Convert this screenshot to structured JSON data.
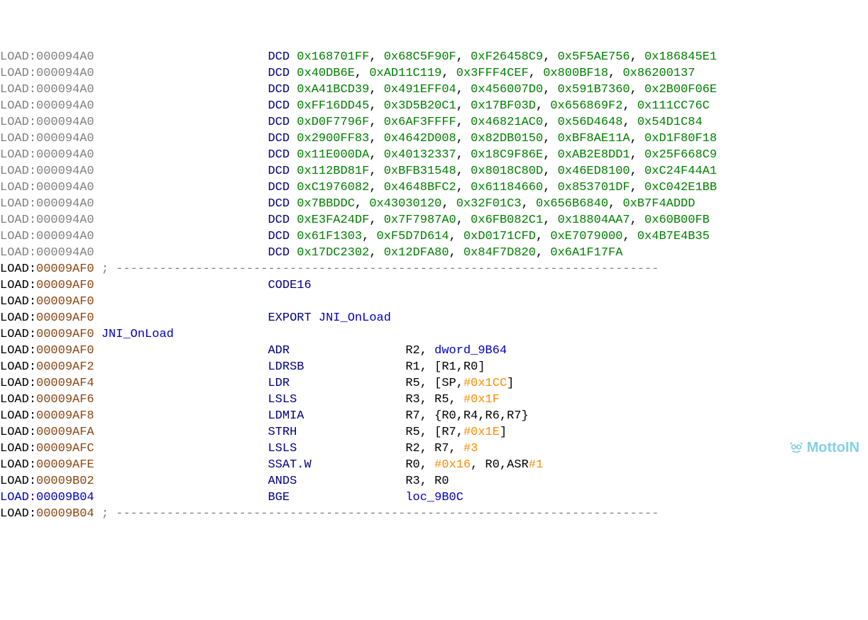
{
  "rows": [
    {
      "addrColor": "gray",
      "addr": "000094A0",
      "type": "dcd",
      "vals": [
        "0x168701FF",
        "0x68C5F90F",
        "0xF26458C9",
        "0x5F5AE756",
        "0x186845E1"
      ]
    },
    {
      "addrColor": "gray",
      "addr": "000094A0",
      "type": "dcd",
      "vals": [
        "0x40DB6E",
        "0xAD11C119",
        "0x3FFF4CEF",
        "0x800BF18",
        "0x86200137"
      ]
    },
    {
      "addrColor": "gray",
      "addr": "000094A0",
      "type": "dcd",
      "vals": [
        "0xA41BCD39",
        "0x491EFF04",
        "0x456007D0",
        "0x591B7360",
        "0x2B00F06E"
      ]
    },
    {
      "addrColor": "gray",
      "addr": "000094A0",
      "type": "dcd",
      "vals": [
        "0xFF16DD45",
        "0x3D5B20C1",
        "0x17BF03D",
        "0x656869F2",
        "0x111CC76C"
      ]
    },
    {
      "addrColor": "gray",
      "addr": "000094A0",
      "type": "dcd",
      "vals": [
        "0xD0F7796F",
        "0x6AF3FFFF",
        "0x46821AC0",
        "0x56D4648",
        "0x54D1C84"
      ]
    },
    {
      "addrColor": "gray",
      "addr": "000094A0",
      "type": "dcd",
      "vals": [
        "0x2900FF83",
        "0x4642D008",
        "0x82DB0150",
        "0xBF8AE11A",
        "0xD1F80F18"
      ]
    },
    {
      "addrColor": "gray",
      "addr": "000094A0",
      "type": "dcd",
      "vals": [
        "0x11E000DA",
        "0x40132337",
        "0x18C9F86E",
        "0xAB2E8DD1",
        "0x25F668C9"
      ]
    },
    {
      "addrColor": "gray",
      "addr": "000094A0",
      "type": "dcd",
      "vals": [
        "0x112BD81F",
        "0xBFB31548",
        "0x8018C80D",
        "0x46ED8100",
        "0xC24F44A1"
      ]
    },
    {
      "addrColor": "gray",
      "addr": "000094A0",
      "type": "dcd",
      "vals": [
        "0xC1976082",
        "0x4648BFC2",
        "0x61184660",
        "0x853701DF",
        "0xC042E1BB"
      ]
    },
    {
      "addrColor": "gray",
      "addr": "000094A0",
      "type": "dcd",
      "vals": [
        "0x7BBDDC",
        "0x43030120",
        "0x32F01C3",
        "0x656B6840",
        "0xB7F4ADDD"
      ]
    },
    {
      "addrColor": "gray",
      "addr": "000094A0",
      "type": "dcd",
      "vals": [
        "0xE3FA24DF",
        "0x7F7987A0",
        "0x6FB082C1",
        "0x18804AA7",
        "0x60B00FB"
      ]
    },
    {
      "addrColor": "gray",
      "addr": "000094A0",
      "type": "dcd",
      "vals": [
        "0x61F1303",
        "0xF5D7D614",
        "0xD0171CFD",
        "0xE7079000",
        "0x4B7E4B35"
      ]
    },
    {
      "addrColor": "gray",
      "addr": "000094A0",
      "type": "dcd",
      "vals": [
        "0x17DC2302",
        "0x12DFA80",
        "0x84F7D820",
        "0x6A1F17FA"
      ]
    },
    {
      "addrColor": "brown",
      "addr": "00009AF0",
      "type": "sep"
    },
    {
      "addrColor": "brown",
      "addr": "00009AF0",
      "type": "plain",
      "mnemonic": "CODE16"
    },
    {
      "addrColor": "brown",
      "addr": "00009AF0",
      "type": "blank"
    },
    {
      "addrColor": "brown",
      "addr": "00009AF0",
      "type": "export",
      "mnemonic": "EXPORT",
      "target": "JNI_OnLoad"
    },
    {
      "addrColor": "brown",
      "addr": "00009AF0",
      "type": "label",
      "label": "JNI_OnLoad"
    },
    {
      "addrColor": "brown",
      "addr": "00009AF0",
      "type": "instr",
      "mnemonic": "ADR",
      "ops": [
        {
          "t": "plain",
          "v": "R2, "
        },
        {
          "t": "label",
          "v": "dword_9B64"
        }
      ]
    },
    {
      "addrColor": "brown",
      "addr": "00009AF2",
      "type": "instr",
      "mnemonic": "LDRSB",
      "ops": [
        {
          "t": "plain",
          "v": "R1, [R1,R0]"
        }
      ]
    },
    {
      "addrColor": "brown",
      "addr": "00009AF4",
      "type": "instr",
      "mnemonic": "LDR",
      "ops": [
        {
          "t": "plain",
          "v": "R5, [SP,"
        },
        {
          "t": "imm",
          "v": "#0x1CC"
        },
        {
          "t": "plain",
          "v": "]"
        }
      ]
    },
    {
      "addrColor": "brown",
      "addr": "00009AF6",
      "type": "instr",
      "mnemonic": "LSLS",
      "ops": [
        {
          "t": "plain",
          "v": "R3, R5, "
        },
        {
          "t": "imm",
          "v": "#0x1F"
        }
      ]
    },
    {
      "addrColor": "brown",
      "addr": "00009AF8",
      "type": "instr",
      "mnemonic": "LDMIA",
      "ops": [
        {
          "t": "plain",
          "v": "R7, {R0,R4,R6,R7}"
        }
      ]
    },
    {
      "addrColor": "brown",
      "addr": "00009AFA",
      "type": "instr",
      "mnemonic": "STRH",
      "ops": [
        {
          "t": "plain",
          "v": "R5, [R7,"
        },
        {
          "t": "imm",
          "v": "#0x1E"
        },
        {
          "t": "plain",
          "v": "]"
        }
      ]
    },
    {
      "addrColor": "brown",
      "addr": "00009AFC",
      "type": "instr",
      "mnemonic": "LSLS",
      "ops": [
        {
          "t": "plain",
          "v": "R2, R7, "
        },
        {
          "t": "imm",
          "v": "#3"
        }
      ]
    },
    {
      "addrColor": "brown",
      "addr": "00009AFE",
      "type": "instr",
      "mnemonic": "SSAT.W",
      "ops": [
        {
          "t": "plain",
          "v": "R0, "
        },
        {
          "t": "imm",
          "v": "#0x16"
        },
        {
          "t": "plain",
          "v": ", R0,ASR"
        },
        {
          "t": "imm",
          "v": "#1"
        }
      ]
    },
    {
      "addrColor": "brown",
      "addr": "00009B02",
      "type": "instr",
      "mnemonic": "ANDS",
      "ops": [
        {
          "t": "plain",
          "v": "R3, R0"
        }
      ]
    },
    {
      "addrColor": "blue",
      "addr": "00009B04",
      "type": "instr",
      "mnemonic": "BGE",
      "ops": [
        {
          "t": "label",
          "v": "loc_9B0C"
        }
      ]
    },
    {
      "addrColor": "brown",
      "addr": "00009B04",
      "type": "sep"
    }
  ],
  "segment": "LOAD",
  "watermark": "MottoIN"
}
